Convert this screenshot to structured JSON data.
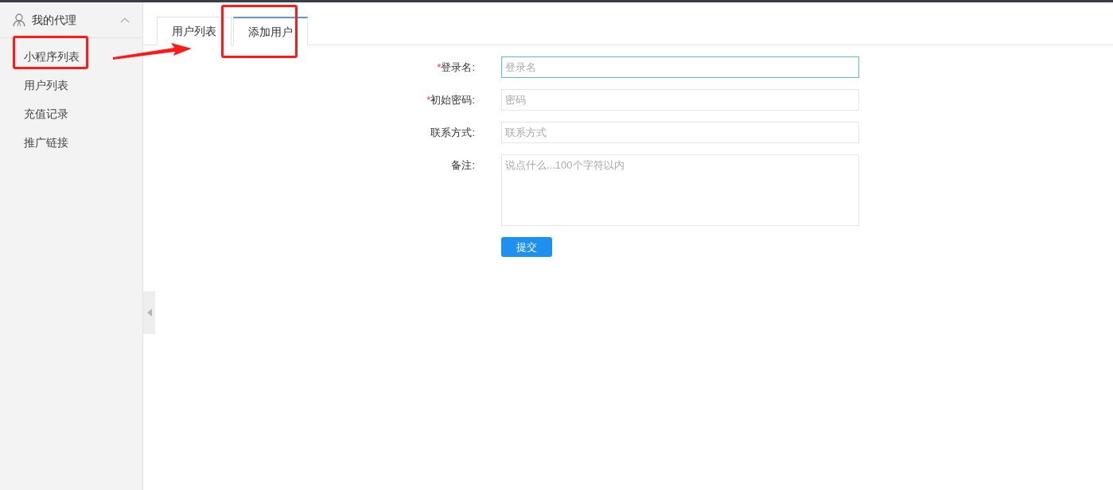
{
  "sidebar": {
    "group": {
      "title": "我的代理",
      "expanded": true
    },
    "items": [
      {
        "label": "小程序列表",
        "selected": false
      },
      {
        "label": "用户列表",
        "selected": false
      },
      {
        "label": "充值记录",
        "selected": false
      },
      {
        "label": "推广链接",
        "selected": false
      }
    ]
  },
  "tabs": [
    {
      "label": "用户列表",
      "selected": false
    },
    {
      "label": "添加用户",
      "selected": true
    }
  ],
  "form": {
    "fields": [
      {
        "kind": "input",
        "required_mark": "*",
        "label": "登录名:",
        "placeholder": "登录名",
        "focused": true
      },
      {
        "kind": "input",
        "required_mark": "*",
        "label": "初始密码:",
        "placeholder": "密码",
        "focused": false
      },
      {
        "kind": "input",
        "label": "联系方式:",
        "placeholder": "联系方式",
        "focused": false
      },
      {
        "kind": "textarea",
        "label": "备注:",
        "placeholder": "说点什么...100个字符以内",
        "focused": false
      }
    ],
    "submit": "提交"
  }
}
